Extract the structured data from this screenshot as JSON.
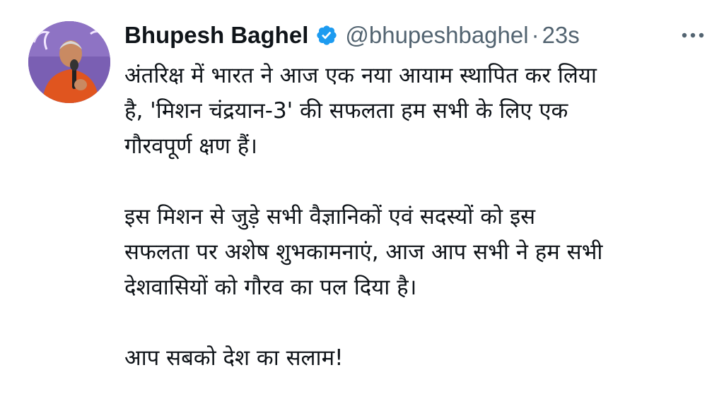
{
  "author": {
    "display_name": "Bhupesh Baghel",
    "handle": "@bhupeshbaghel",
    "separator": "·",
    "timestamp": "23s",
    "verified": true,
    "verified_color": "#1d9bf0"
  },
  "tweet": {
    "paragraphs": [
      [
        "अंतरिक्ष में भारत ने आज एक नया आयाम स्थापित कर लिया",
        "है, 'मिशन चंद्रयान-3' की सफलता हम सभी के लिए एक",
        "गौरवपूर्ण क्षण हैं।"
      ],
      [
        "इस मिशन से जुड़े सभी वैज्ञानिकों एवं सदस्यों को इस",
        "सफलता पर अशेष शुभकामनाएं, आज आप सभी ने हम सभी",
        "देशवासियों को गौरव का पल दिया है।"
      ],
      [
        "आप सबको देश का सलाम!"
      ]
    ]
  },
  "icons": {
    "verified": "verified-badge-icon",
    "more": "more-options-icon"
  },
  "colors": {
    "text": "#0f1419",
    "secondary": "#536471",
    "avatar_bg": "#7a5fb3",
    "avatar_shirt": "#e0551f"
  }
}
